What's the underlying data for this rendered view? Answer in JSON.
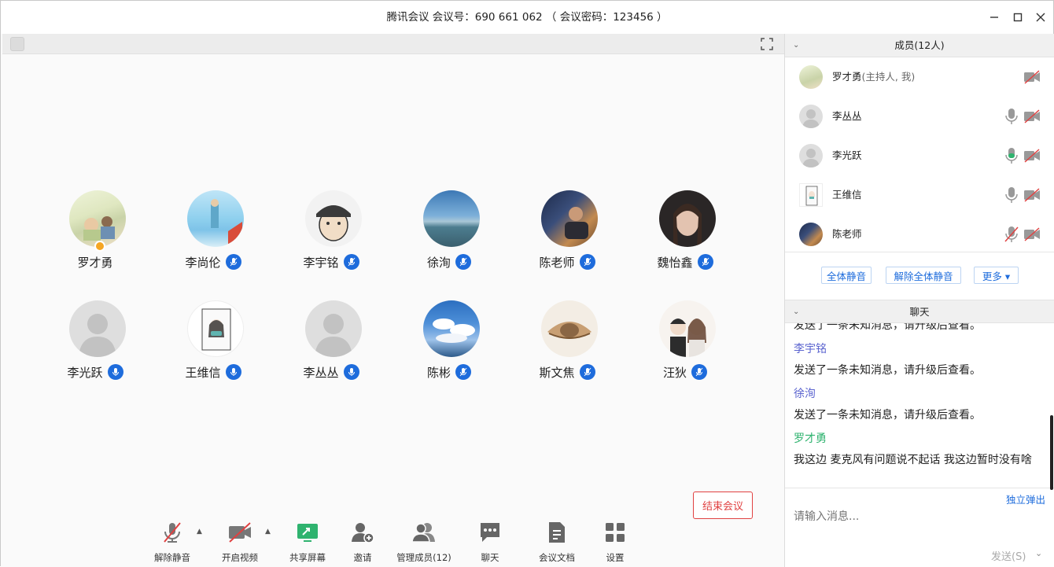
{
  "window": {
    "title": "腾讯会议 会议号：690 661 062 （ 会议密码：123456 ）"
  },
  "participants": [
    {
      "name": "罗才勇"
    },
    {
      "name": "李尚伦"
    },
    {
      "name": "李宇铭"
    },
    {
      "name": "徐洵"
    },
    {
      "name": "陈老师"
    },
    {
      "name": "魏怡鑫"
    },
    {
      "name": "李光跃"
    },
    {
      "name": "王维信"
    },
    {
      "name": "李丛丛"
    },
    {
      "name": "陈彬"
    },
    {
      "name": "斯文焦"
    },
    {
      "name": "汪狄"
    }
  ],
  "toolbar": {
    "unmute": "解除静音",
    "start_video": "开启视频",
    "share_screen": "共享屏幕",
    "invite": "邀请",
    "manage_members": "管理成员(12)",
    "chat": "聊天",
    "docs": "会议文档",
    "settings": "设置",
    "end_meeting": "结束会议"
  },
  "members_panel": {
    "header": "成员(12人)",
    "members": [
      {
        "name": "罗才勇",
        "note": "(主持人, 我)"
      },
      {
        "name": "李丛丛",
        "note": ""
      },
      {
        "name": "李光跃",
        "note": ""
      },
      {
        "name": "王维信",
        "note": ""
      },
      {
        "name": "陈老师",
        "note": ""
      }
    ],
    "mute_all": "全体静音",
    "unmute_all": "解除全体静音",
    "more": "更多 ▾"
  },
  "chat_panel": {
    "header": "聊天",
    "messages": [
      {
        "sender": "",
        "text": "发送了一条未知消息，请升级后查看。"
      },
      {
        "sender": "李宇铭",
        "text": "发送了一条未知消息，请升级后查看。"
      },
      {
        "sender": "徐洵",
        "text": "发送了一条未知消息，请升级后查看。"
      },
      {
        "sender": "罗才勇",
        "text": "我这边 麦克风有问题说不起话 我这边暂时没有啥"
      }
    ],
    "popout": "独立弹出",
    "input_placeholder": "请输入消息...",
    "send": "发送(S)"
  },
  "colors": {
    "accent_blue": "#1e6cdc",
    "end_red": "#e04141",
    "host_green": "#2fb36f",
    "sender_purple": "#5a63cf"
  }
}
